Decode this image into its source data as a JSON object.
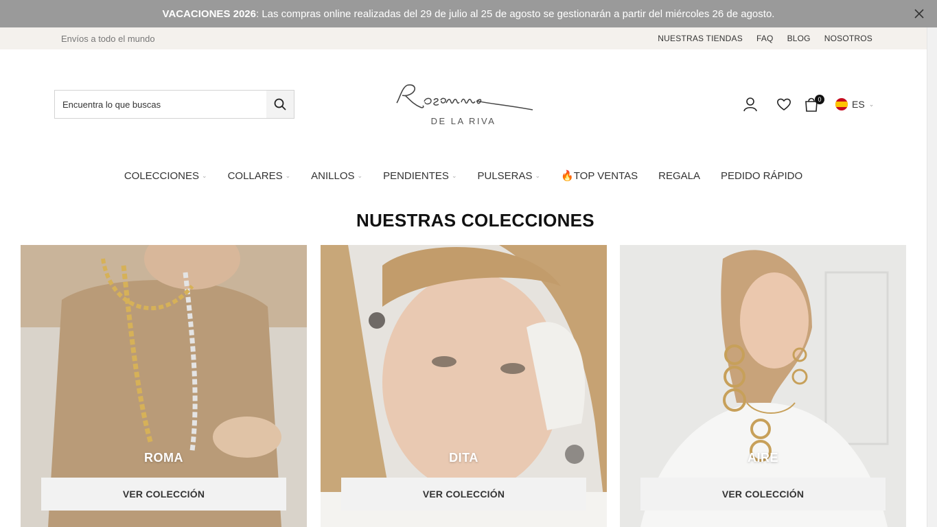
{
  "announcement": {
    "bold": "VACACIONES 2026",
    "text": ": Las compras online realizadas del 29 de julio al 25 de agosto se gestionarán a partir del miércoles 26 de agosto.",
    "close_icon": "close-icon"
  },
  "topbar": {
    "left_text": "Envíos a todo el mundo",
    "links": [
      "NUESTRAS TIENDAS",
      "FAQ",
      "BLOG",
      "NOSOTROS"
    ]
  },
  "search": {
    "placeholder": "Encuentra lo que buscas",
    "icon": "search-icon"
  },
  "logo": {
    "script": "Rosanne",
    "sub": "DE LA RIVA"
  },
  "header_icons": {
    "account": "user-icon",
    "wishlist": "heart-icon",
    "cart": "shopping-bag-icon",
    "cart_count": "0",
    "language": "ES"
  },
  "nav": {
    "items": [
      {
        "label": "COLECCIONES",
        "has_dropdown": true
      },
      {
        "label": "COLLARES",
        "has_dropdown": true
      },
      {
        "label": "ANILLOS",
        "has_dropdown": true
      },
      {
        "label": "PENDIENTES",
        "has_dropdown": true
      },
      {
        "label": "PULSERAS",
        "has_dropdown": true
      },
      {
        "label": "🔥TOP VENTAS",
        "has_dropdown": false
      },
      {
        "label": "REGALA",
        "has_dropdown": false
      },
      {
        "label": "PEDIDO RÁPIDO",
        "has_dropdown": false
      }
    ]
  },
  "collections": {
    "title": "NUESTRAS COLECCIONES",
    "cards": [
      {
        "name": "ROMA",
        "cta": "VER COLECCIÓN"
      },
      {
        "name": "DITA",
        "cta": "VER COLECCIÓN"
      },
      {
        "name": "AIRE",
        "cta": "VER COLECCIÓN"
      }
    ]
  },
  "colors": {
    "announcement_bg": "#9a9a9a",
    "topbar_bg": "#f4f1ed",
    "cta_bg": "#f2f2f2"
  }
}
